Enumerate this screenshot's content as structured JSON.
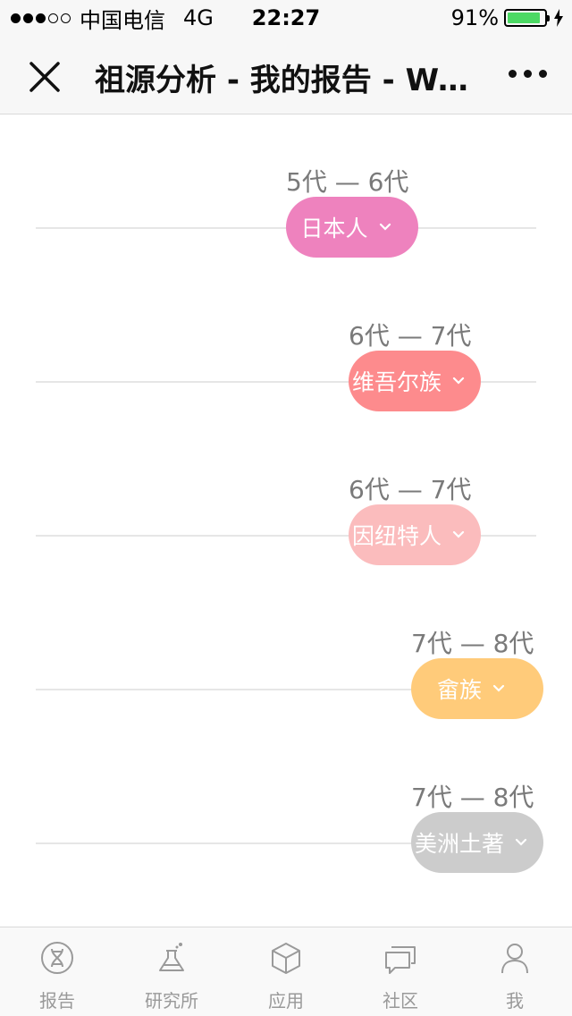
{
  "status_bar": {
    "carrier": "中国电信",
    "network": "4G",
    "time": "22:27",
    "battery_text": "91%",
    "battery_level": 0.91
  },
  "nav": {
    "title": "祖源分析 - 我的报告 - WeGene"
  },
  "timeline": [
    {
      "generations": "5代 — 6代",
      "label": "日本人",
      "color": "#ee82be"
    },
    {
      "generations": "6代 — 7代",
      "label": "维吾尔族",
      "color": "#fd8b8d"
    },
    {
      "generations": "6代 — 7代",
      "label": "因纽特人",
      "color": "#fbbcbd"
    },
    {
      "generations": "7代 — 8代",
      "label": "畲族",
      "color": "#ffcb7a"
    },
    {
      "generations": "7代 — 8代",
      "label": "美洲土著",
      "color": "#cccccc"
    }
  ],
  "tabs": [
    {
      "label": "报告",
      "icon": "dna-icon"
    },
    {
      "label": "研究所",
      "icon": "flask-icon"
    },
    {
      "label": "应用",
      "icon": "cube-icon"
    },
    {
      "label": "社区",
      "icon": "chat-bubbles-icon"
    },
    {
      "label": "我",
      "icon": "person-icon"
    }
  ]
}
